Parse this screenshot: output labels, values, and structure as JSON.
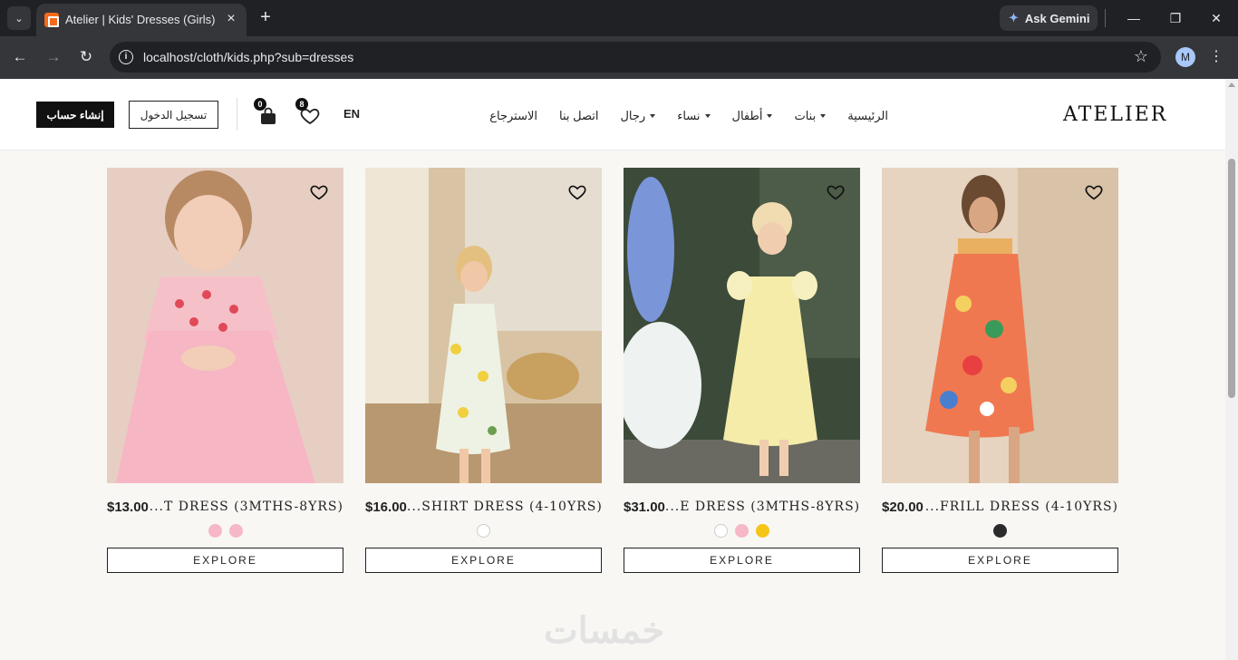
{
  "browser": {
    "tab_title": "Atelier | Kids' Dresses (Girls)",
    "url": "localhost/cloth/kids.php?sub=dresses",
    "gemini_label": "Ask Gemini",
    "avatar_letter": "M"
  },
  "header": {
    "logo": "ATELIER",
    "nav": [
      {
        "label": "الرئيسية",
        "dropdown": false
      },
      {
        "label": "بنات",
        "dropdown": true
      },
      {
        "label": "أطفال",
        "dropdown": true
      },
      {
        "label": "نساء",
        "dropdown": true
      },
      {
        "label": "رجال",
        "dropdown": true
      },
      {
        "label": "اتصل بنا",
        "dropdown": false
      },
      {
        "label": "الاسترجاع",
        "dropdown": false
      }
    ],
    "language": "EN",
    "wishlist_count": "8",
    "cart_count": "0",
    "login_label": "تسجيل الدخول",
    "signup_label": "إنشاء حساب"
  },
  "products": [
    {
      "name": "T DRESS (3MTHS-8YRS)...",
      "price": "$13.00",
      "swatches": [
        "#f6b8c6",
        "#f6b8c6"
      ],
      "explore_label": "EXPLORE",
      "scene": "pink"
    },
    {
      "name": "SHIRT DRESS (4-10YRS)...",
      "price": "$16.00",
      "swatches": [
        "#ffffff"
      ],
      "explore_label": "EXPLORE",
      "scene": "lemon"
    },
    {
      "name": "E DRESS (3MTHS-8YRS)...",
      "price": "$31.00",
      "swatches": [
        "#ffffff",
        "#f6b8c6",
        "#f5c518"
      ],
      "explore_label": "EXPLORE",
      "scene": "yellow"
    },
    {
      "name": "FRILL DRESS (4-10YRS)...",
      "price": "$20.00",
      "swatches": [
        "#2b2b2b"
      ],
      "explore_label": "EXPLORE",
      "scene": "floral"
    }
  ],
  "watermark": "خمسات"
}
